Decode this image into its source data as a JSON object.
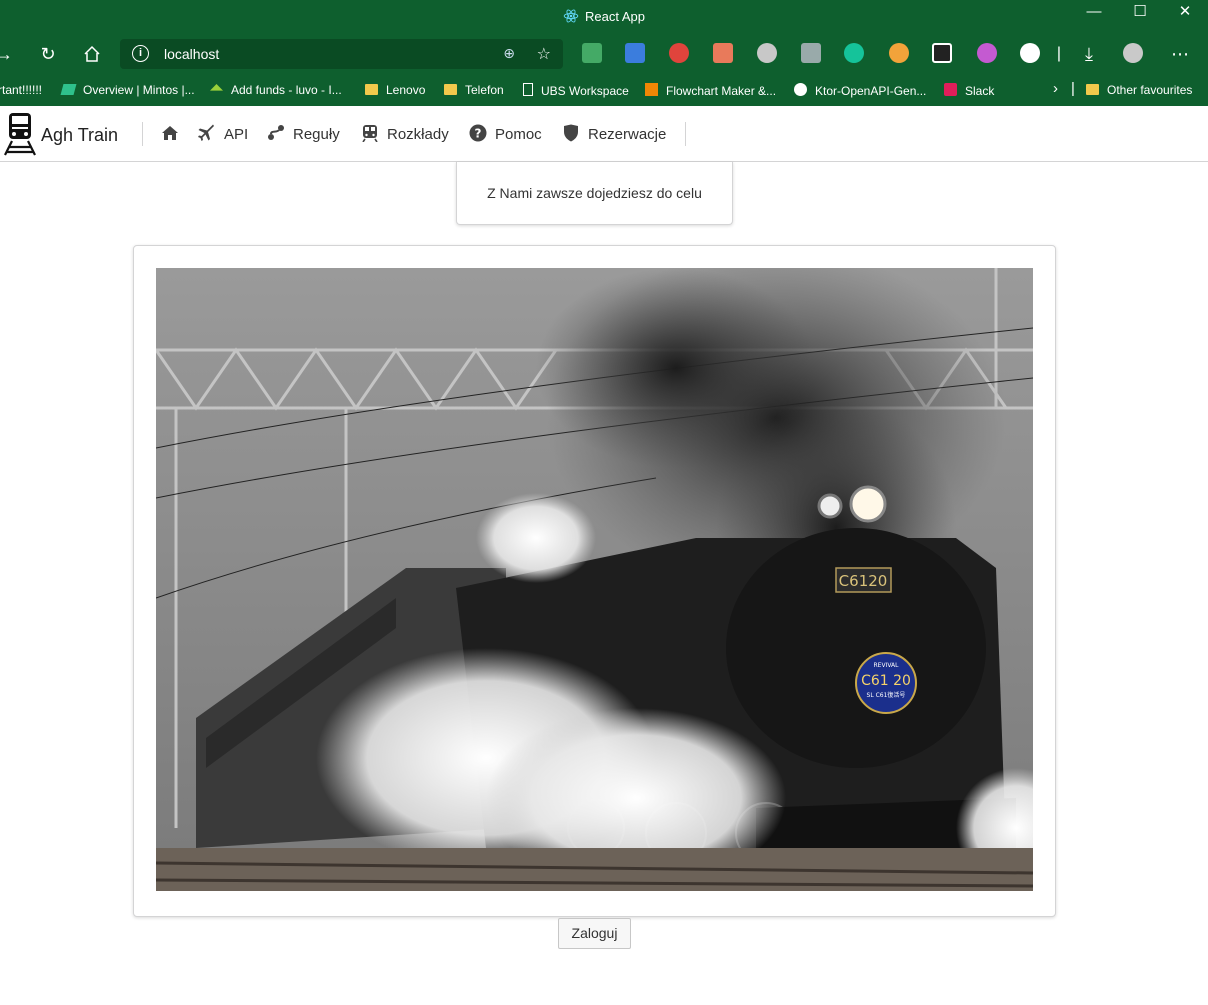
{
  "window": {
    "title": "React App",
    "controls": {
      "minimize": "—",
      "maximize": "☐",
      "close": "✕"
    }
  },
  "browser": {
    "url": "localhost",
    "bookmarks": [
      {
        "label": "rtant!!!!!!",
        "icon": "none"
      },
      {
        "label": "Overview | Mintos |...",
        "icon": "mintos-icon"
      },
      {
        "label": "Add funds - luvo - I...",
        "icon": "iuvo-icon"
      },
      {
        "label": "Lenovo",
        "icon": "folder-icon"
      },
      {
        "label": "Telefon",
        "icon": "folder-icon"
      },
      {
        "label": "UBS Workspace",
        "icon": "page-icon"
      },
      {
        "label": "Flowchart Maker &...",
        "icon": "drawio-icon"
      },
      {
        "label": "Ktor-OpenAPI-Gen...",
        "icon": "github-icon"
      },
      {
        "label": "Slack",
        "icon": "slack-icon"
      },
      {
        "label": "Other favourites",
        "icon": "folder-icon"
      }
    ]
  },
  "app": {
    "brand": "Agh Train",
    "menu": [
      {
        "label": "",
        "icon": "home-icon"
      },
      {
        "label": "API",
        "icon": "plane-icon"
      },
      {
        "label": "Reguły",
        "icon": "route-icon"
      },
      {
        "label": "Rozkłady",
        "icon": "subway-icon"
      },
      {
        "label": "Pomoc",
        "icon": "question-circle-icon"
      },
      {
        "label": "Rezerwacje",
        "icon": "shield-icon"
      }
    ],
    "motto": "Z Nami zawsze dojedziesz do celu",
    "image": {
      "subject": "steam-locomotive-photo",
      "plate": "C6120",
      "badge_line1": "REVIVAL",
      "badge_line2": "C61 20",
      "badge_line3": "SL C61復活号"
    },
    "login_label": "Zaloguj"
  }
}
